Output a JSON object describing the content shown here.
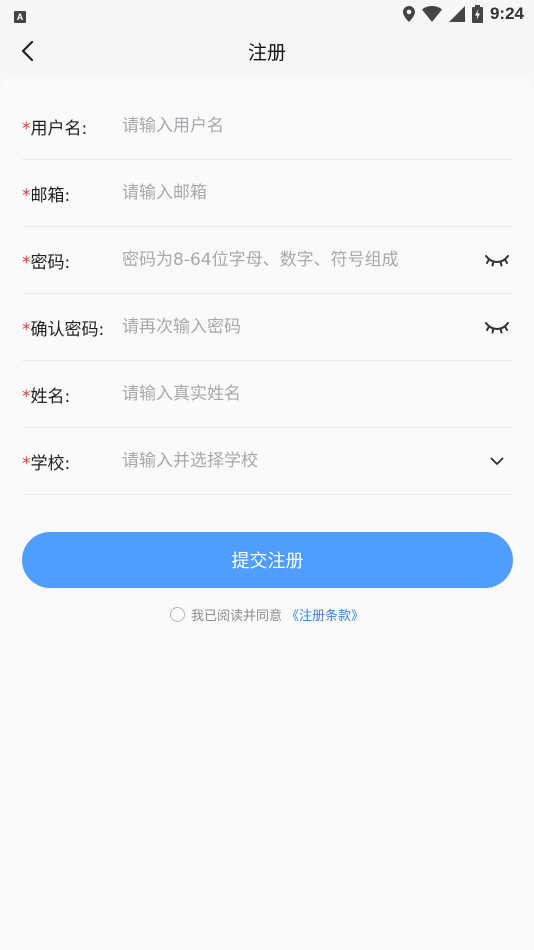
{
  "status_bar": {
    "time": "9:24",
    "app_indicator": "A"
  },
  "nav": {
    "title": "注册"
  },
  "form": {
    "rows": [
      {
        "required_mark": "*",
        "label": "用户名:",
        "placeholder": "请输入用户名"
      },
      {
        "required_mark": "*",
        "label": "邮箱:",
        "placeholder": "请输入邮箱"
      },
      {
        "required_mark": "*",
        "label": "密码:",
        "placeholder": "密码为8-64位字母、数字、符号组成"
      },
      {
        "required_mark": "*",
        "label": "确认密码:",
        "placeholder": "请再次输入密码"
      },
      {
        "required_mark": "*",
        "label": "姓名:",
        "placeholder": "请输入真实姓名"
      },
      {
        "required_mark": "*",
        "label": "学校:",
        "placeholder": "请输入并选择学校"
      }
    ]
  },
  "submit": {
    "label": "提交注册"
  },
  "agreement": {
    "text": "我已阅读并同意",
    "link": "《注册条款》"
  },
  "colors": {
    "primary": "#4f9dff",
    "required": "#e53935",
    "link": "#3a82f0"
  }
}
